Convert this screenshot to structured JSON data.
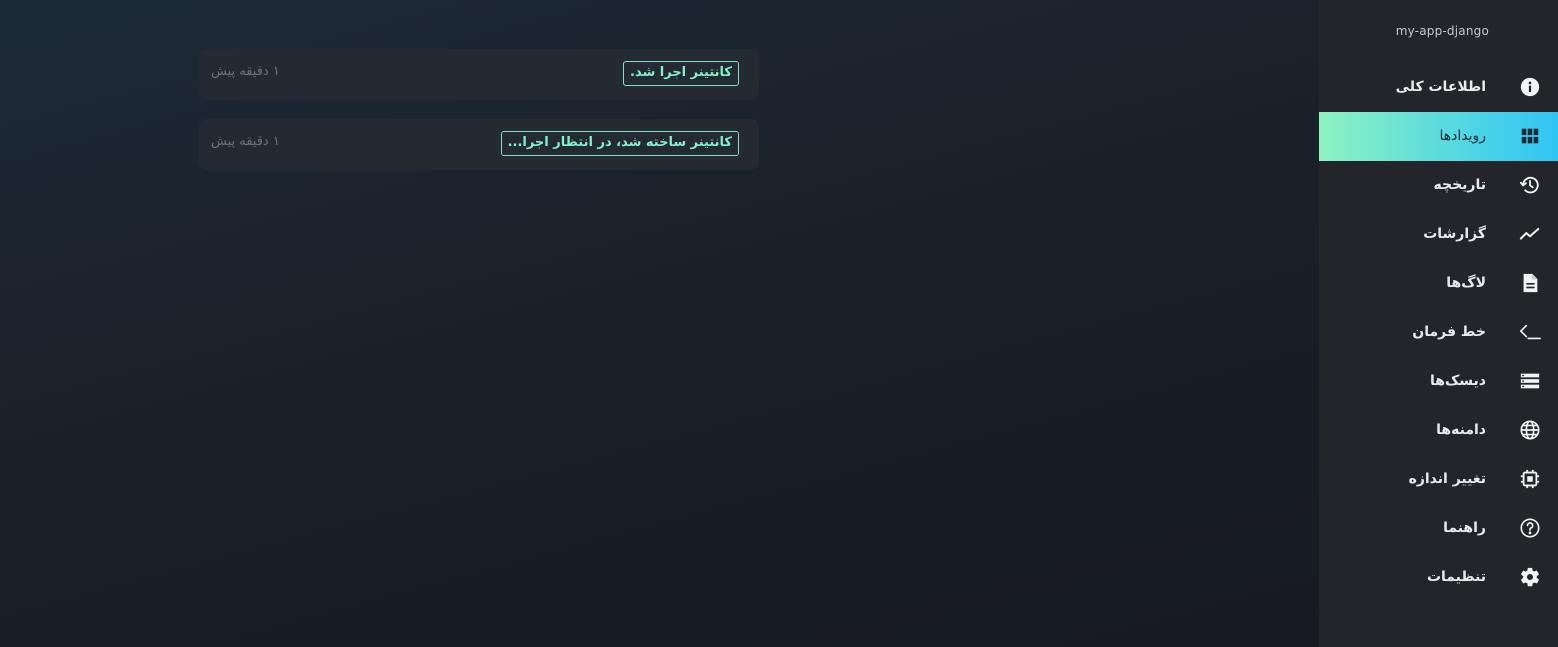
{
  "events": [
    {
      "message": "کانتینر اجرا شد.",
      "time": "۱ دقیقه پیش"
    },
    {
      "message": "کانتینر ساخته شد، در انتظار اجرا...",
      "time": "۱ دقیقه پیش"
    }
  ],
  "sidebar": {
    "app_name": "my-app-django",
    "items": [
      {
        "label": "اطلاعات کلی",
        "icon": "info-icon"
      },
      {
        "label": "رویدادها",
        "icon": "grid-icon",
        "active": true
      },
      {
        "label": "تاریخچه",
        "icon": "history-icon"
      },
      {
        "label": "گزارشات",
        "icon": "chart-line-icon"
      },
      {
        "label": "لاگ‌ها",
        "icon": "file-text-icon"
      },
      {
        "label": "خط فرمان",
        "icon": "terminal-icon"
      },
      {
        "label": "دیسک‌ها",
        "icon": "storage-icon"
      },
      {
        "label": "دامنه‌ها",
        "icon": "globe-icon"
      },
      {
        "label": "تغییر اندازه",
        "icon": "chip-icon"
      },
      {
        "label": "راهنما",
        "icon": "help-icon"
      },
      {
        "label": "تنظیمات",
        "icon": "gear-icon"
      }
    ]
  },
  "colors": {
    "accent_start": "#8df3c1",
    "accent_end": "#2fc4f3",
    "event_border": "#7fe3bf",
    "sidebar_bg": "#23252b"
  }
}
